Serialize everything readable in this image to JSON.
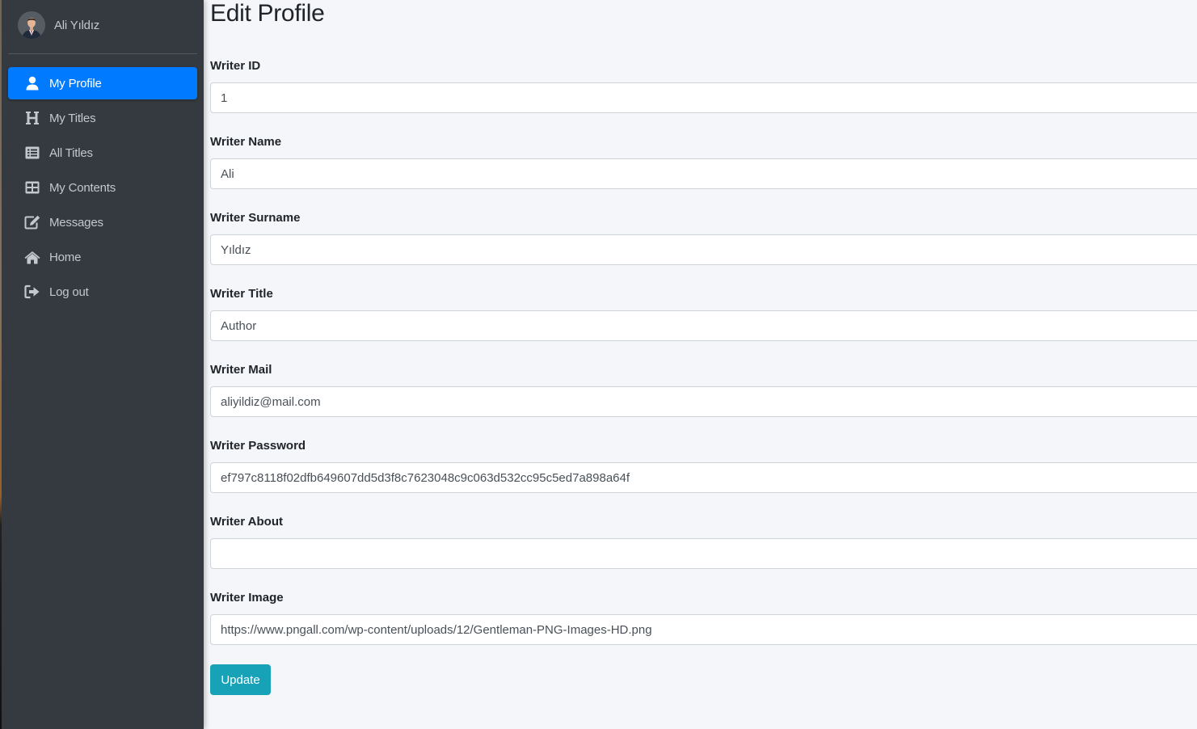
{
  "sidebar": {
    "user": {
      "name": "Ali Yıldız",
      "avatar_icon": "gentleman-avatar"
    },
    "items": [
      {
        "label": "My Profile",
        "icon": "user-icon",
        "active": true
      },
      {
        "label": "My Titles",
        "icon": "heading-icon",
        "active": false
      },
      {
        "label": "All Titles",
        "icon": "list-alt-icon",
        "active": false
      },
      {
        "label": "My Contents",
        "icon": "th-large-icon",
        "active": false
      },
      {
        "label": "Messages",
        "icon": "edit-icon",
        "active": false
      },
      {
        "label": "Home",
        "icon": "home-icon",
        "active": false
      },
      {
        "label": "Log out",
        "icon": "sign-out-icon",
        "active": false
      }
    ]
  },
  "main": {
    "title": "Edit Profile",
    "fields": [
      {
        "label": "Writer ID",
        "value": "1"
      },
      {
        "label": "Writer Name",
        "value": "Ali"
      },
      {
        "label": "Writer Surname",
        "value": "Yıldız"
      },
      {
        "label": "Writer Title",
        "value": "Author"
      },
      {
        "label": "Writer Mail",
        "value": "aliyildiz@mail.com"
      },
      {
        "label": "Writer Password",
        "value": "ef797c8118f02dfb649607dd5d3f8c7623048c9c063d532cc95c5ed7a898a64f"
      },
      {
        "label": "Writer About",
        "value": ""
      },
      {
        "label": "Writer Image",
        "value": "https://www.pngall.com/wp-content/uploads/12/Gentleman-PNG-Images-HD.png"
      }
    ],
    "submit_label": "Update"
  },
  "colors": {
    "sidebar_bg": "#343a40",
    "active_item": "#007bff",
    "button": "#17a2b8",
    "page_bg": "#f4f6f9"
  }
}
